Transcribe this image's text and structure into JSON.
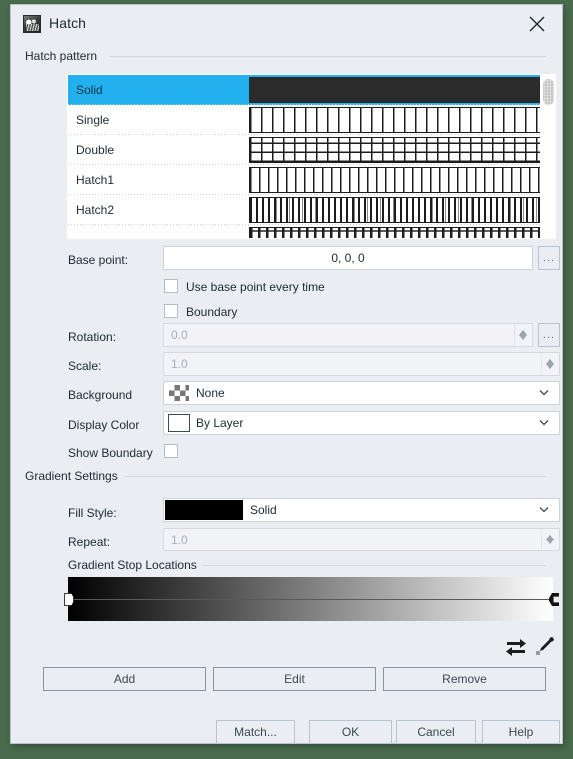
{
  "window": {
    "title": "Hatch",
    "icon": "hatch-app-icon",
    "close_icon": "close-icon",
    "background_color": "#4a6b4d",
    "dialog_color": "#eaedf1"
  },
  "groups": {
    "hatch_pattern": "Hatch pattern",
    "gradient_settings": "Gradient Settings"
  },
  "pattern_list": {
    "selected_index": 0,
    "highlight_color": "#22b0ef",
    "rows": [
      {
        "name": "Solid",
        "preview": "solid"
      },
      {
        "name": "Single",
        "preview": "single"
      },
      {
        "name": "Double",
        "preview": "double"
      },
      {
        "name": "Hatch1",
        "preview": "hatch1"
      },
      {
        "name": "Hatch2",
        "preview": "hatch2"
      },
      {
        "name": "",
        "preview": "hatch3"
      }
    ]
  },
  "fields": {
    "base_point": {
      "label": "Base point:",
      "value": "0, 0, 0",
      "browse_label": "..."
    },
    "use_base_point_every_time": {
      "label": "Use base point every time",
      "checked": false
    },
    "boundary": {
      "label": "Boundary",
      "checked": false
    },
    "rotation": {
      "label": "Rotation:",
      "value": "0.0",
      "disabled": true,
      "browse_label": "..."
    },
    "scale": {
      "label": "Scale:",
      "value": "1.0",
      "disabled": true
    },
    "background": {
      "label": "Background",
      "value": "None",
      "swatch": "checker-transparent-swatch"
    },
    "display_color": {
      "label": "Display Color",
      "value": "By Layer",
      "swatch": "white-color-swatch"
    },
    "show_boundary": {
      "label": "Show Boundary",
      "checked": false
    },
    "fill_style": {
      "label": "Fill Style:",
      "value": "Solid",
      "swatch_color": "#000000"
    },
    "repeat": {
      "label": "Repeat:",
      "value": "1.0",
      "disabled": true
    },
    "gradient_stop_locations": {
      "label": "Gradient Stop Locations",
      "start_color": "#000000",
      "end_color": "#ffffff",
      "stops": [
        "0",
        "100"
      ]
    }
  },
  "tools": {
    "swap_icon": "swap-arrows-icon",
    "pick_icon": "eyedropper-icon"
  },
  "buttons": {
    "add": "Add",
    "edit": "Edit",
    "remove": "Remove",
    "match": "Match...",
    "ok": "OK",
    "cancel": "Cancel",
    "help": "Help"
  }
}
